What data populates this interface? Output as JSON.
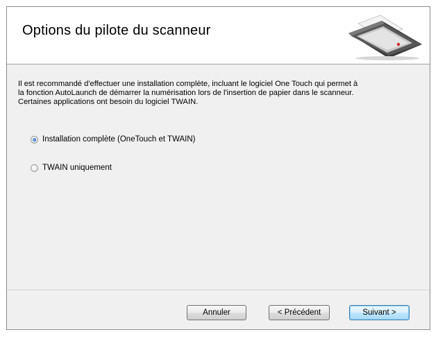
{
  "header": {
    "title": "Options du pilote du scanneur",
    "image_icon": "scanner-icon"
  },
  "content": {
    "description_lines": [
      "Il est recommandé d'effectuer une installation complète, incluant le logiciel One Touch qui permet à",
      "la fonction AutoLaunch de démarrer la numérisation lors de l'insertion de papier dans le scanneur.",
      "Certaines applications ont besoin du logiciel TWAIN."
    ],
    "options": [
      {
        "label": "Installation complète (OneTouch et TWAIN)",
        "selected": true
      },
      {
        "label": "TWAIN uniquement",
        "selected": false
      }
    ]
  },
  "buttons": {
    "cancel_label": "Annuler",
    "back_label": "< Précédent",
    "next_label": "Suivant >"
  },
  "colors": {
    "dialog_background": "#f0f0f0",
    "header_background": "#ffffff",
    "selected_radio": "#2f6fc4",
    "default_button_border": "#3c7fb1"
  }
}
